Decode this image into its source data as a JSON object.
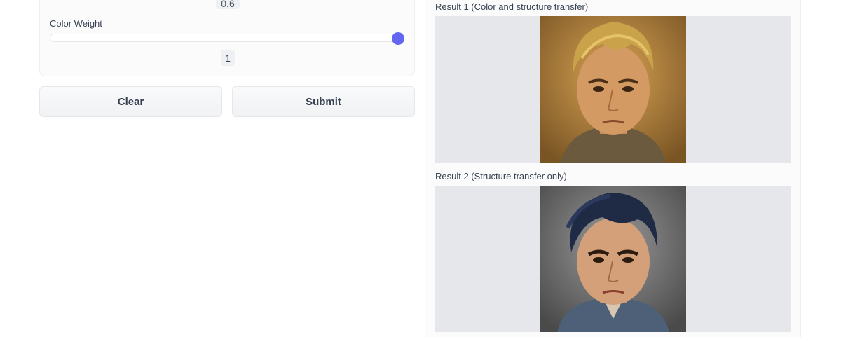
{
  "controls": {
    "previous_slider_value": "0.6",
    "color_weight": {
      "label": "Color Weight",
      "value": "1",
      "fraction": 1.0
    }
  },
  "buttons": {
    "clear_label": "Clear",
    "submit_label": "Submit"
  },
  "results": [
    {
      "label": "Result 1 (Color and structure transfer)"
    },
    {
      "label": "Result 2 (Structure transfer only)"
    }
  ],
  "colors": {
    "accent": "#6366f1",
    "panel_bg": "#fbfbfc",
    "image_bg": "#e6e7ea"
  }
}
